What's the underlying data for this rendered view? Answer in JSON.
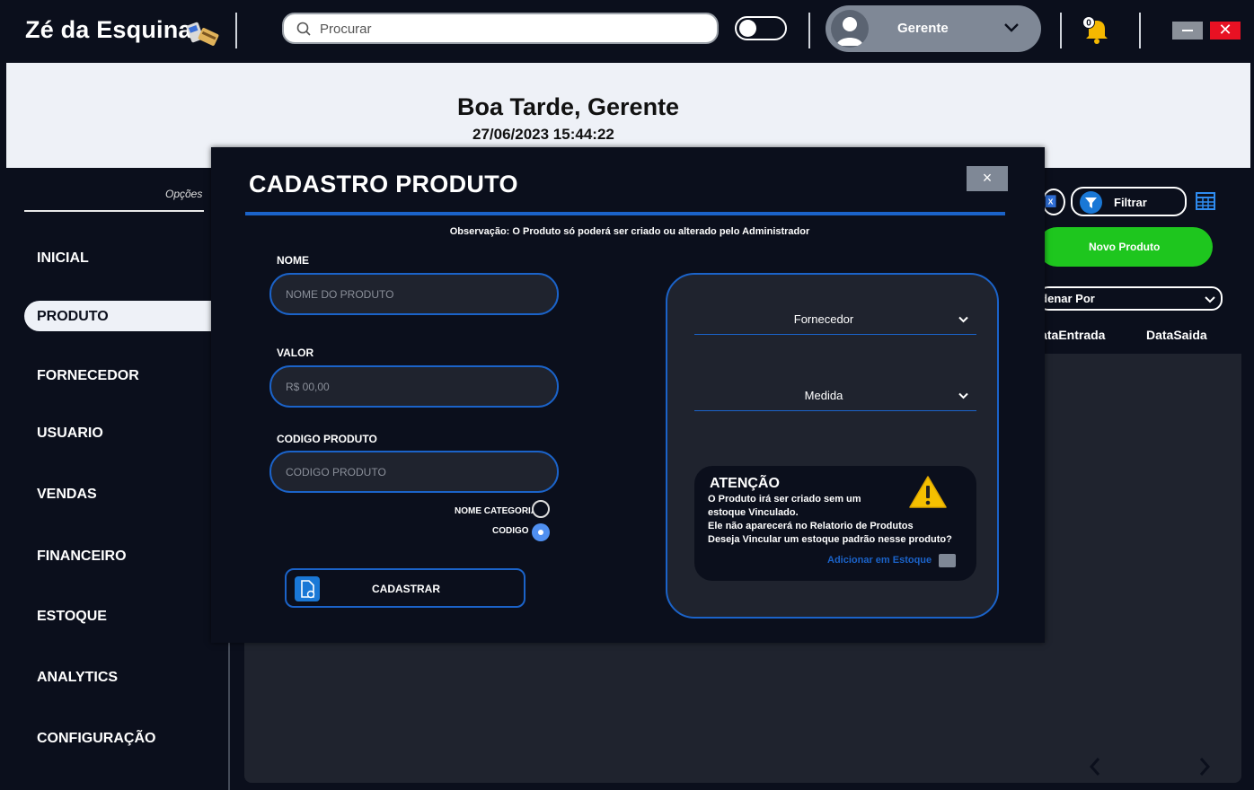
{
  "app": {
    "brand": "Zé da Esquina",
    "search_placeholder": "Procurar",
    "user_name": "Gerente",
    "notification_count": "0"
  },
  "header": {
    "greeting": "Boa Tarde, Gerente",
    "datetime": "27/06/2023 15:44:22"
  },
  "sidebar": {
    "title": "Opções",
    "items": [
      {
        "label": "INICIAL"
      },
      {
        "label": "PRODUTO"
      },
      {
        "label": "FORNECEDOR"
      },
      {
        "label": "USUARIO"
      },
      {
        "label": "VENDAS"
      },
      {
        "label": "FINANCEIRO"
      },
      {
        "label": "ESTOQUE"
      },
      {
        "label": "ANALYTICS"
      },
      {
        "label": "CONFIGURAÇÃO"
      }
    ],
    "active": "PRODUTO"
  },
  "content": {
    "filter_label": "Filtrar",
    "new_button": "Novo Produto",
    "sort_label": "Ordenar Por",
    "columns": [
      "DataEntrada",
      "DataSaida"
    ]
  },
  "modal": {
    "title": "CADASTRO PRODUTO",
    "close": "×",
    "note": "Observação: O Produto só poderá ser criado ou alterado pelo Administrador",
    "fields": {
      "nome_label": "NOME",
      "nome_placeholder": "NOME DO PRODUTO",
      "valor_label": "VALOR",
      "valor_placeholder": "R$ 00,00",
      "codigo_label": "CODIGO PRODUTO",
      "codigo_placeholder": "CODIGO PRODUTO"
    },
    "radios": {
      "categoria": "NOME CATEGORIA",
      "codigo": "CODIGO",
      "selected": "CODIGO"
    },
    "submit": "CADASTRAR",
    "fornecedor": "Fornecedor",
    "medida": "Medida",
    "atencao": {
      "title": "ATENÇÃO",
      "line1": "O Produto irá ser criado sem um",
      "line2": "estoque Vinculado.",
      "line3": "Ele não aparecerá no Relatorio de Produtos",
      "line4": "Deseja Vincular um estoque padrão nesse produto?",
      "link": "Adicionar em Estoque"
    }
  },
  "colors": {
    "accent": "#1b63c9",
    "background": "#0b0f1c",
    "panel": "#1f232e",
    "success": "#1ec61e",
    "danger": "#e81123"
  }
}
